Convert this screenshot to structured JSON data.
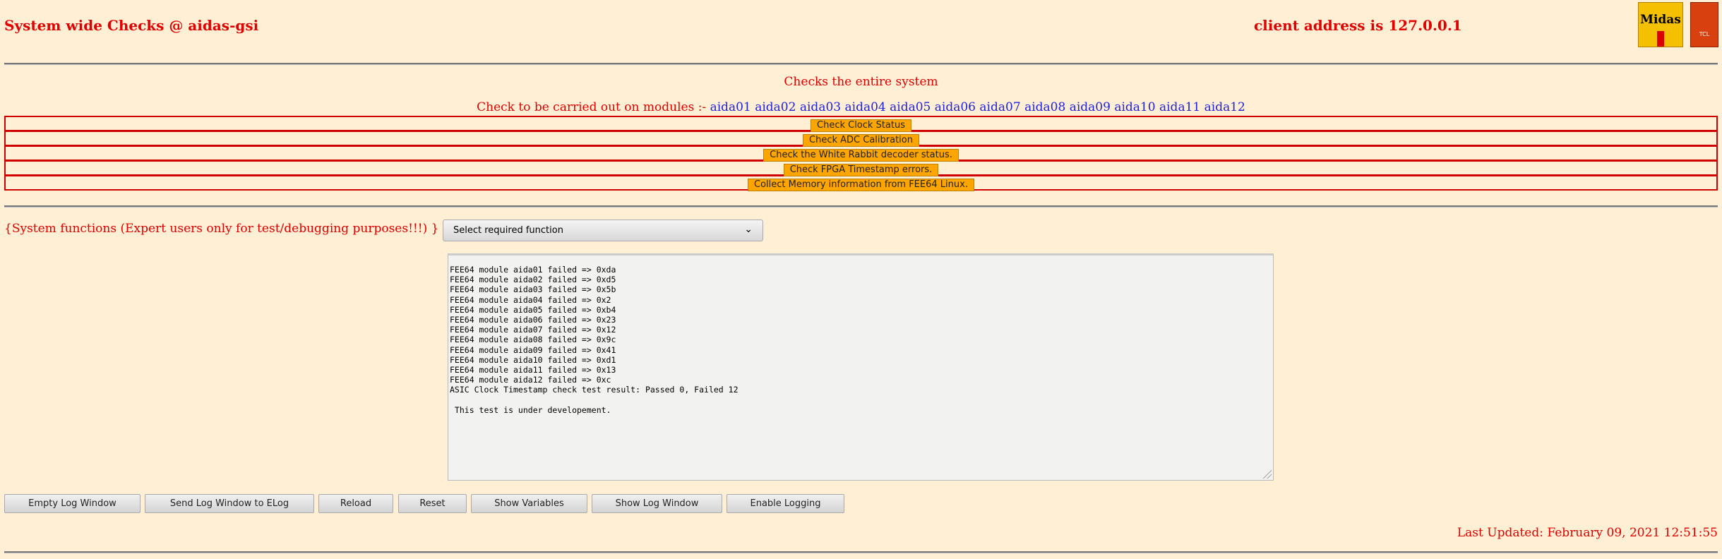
{
  "header": {
    "title": "System wide Checks @ aidas-gsi",
    "client": "client address is 127.0.0.1",
    "logo_text": "Midas",
    "logo2_text": "TCL"
  },
  "main": {
    "subtitle": "Checks the entire system",
    "modules_label": "Check to be carried out on modules :- ",
    "modules": [
      "aida01",
      "aida02",
      "aida03",
      "aida04",
      "aida05",
      "aida06",
      "aida07",
      "aida08",
      "aida09",
      "aida10",
      "aida11",
      "aida12"
    ],
    "checks": [
      "Check Clock Status",
      "Check ADC Calibration",
      "Check the White Rabbit decoder status.",
      "Check FPGA Timestamp errors.",
      "Collect Memory information from FEE64 Linux."
    ]
  },
  "system": {
    "label": "{System functions (Expert users only for test/debugging purposes!!!)  } {",
    "select_value": "Select required function"
  },
  "log": {
    "text": "FEE64 module aida01 failed => 0xda\nFEE64 module aida02 failed => 0xd5\nFEE64 module aida03 failed => 0x5b\nFEE64 module aida04 failed => 0x2\nFEE64 module aida05 failed => 0xb4\nFEE64 module aida06 failed => 0x23\nFEE64 module aida07 failed => 0x12\nFEE64 module aida08 failed => 0x9c\nFEE64 module aida09 failed => 0x41\nFEE64 module aida10 failed => 0xd1\nFEE64 module aida11 failed => 0x13\nFEE64 module aida12 failed => 0xc\nASIC Clock Timestamp check test result: Passed 0, Failed 12\n\n This test is under developement."
  },
  "buttons": [
    "Empty Log Window",
    "Send Log Window to ELog",
    "Reload",
    "Reset",
    "Show Variables",
    "Show Log Window",
    "Enable Logging"
  ],
  "footer": {
    "updated": "Last Updated: February 09, 2021 12:51:55"
  }
}
